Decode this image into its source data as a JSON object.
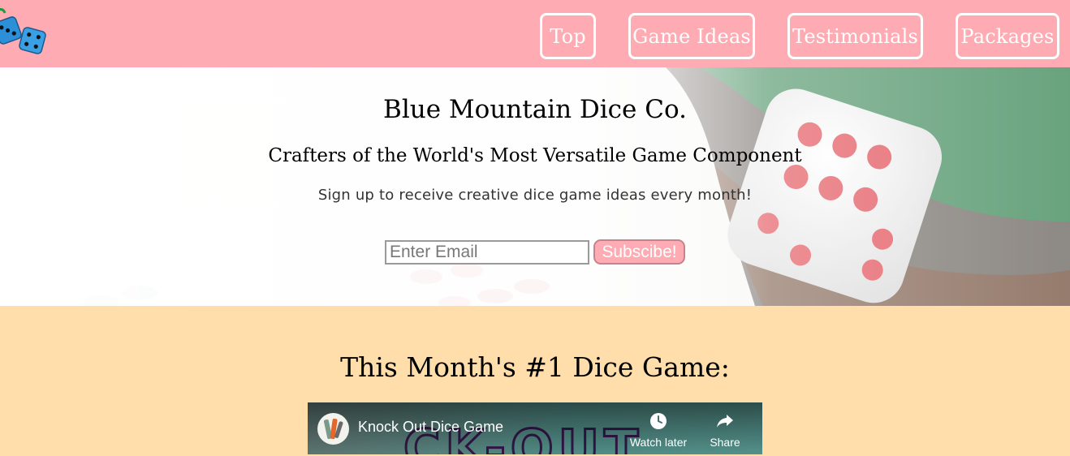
{
  "header": {
    "nav": [
      {
        "label": "Top"
      },
      {
        "label": "Game Ideas"
      },
      {
        "label": "Testimonials"
      },
      {
        "label": "Packages"
      }
    ]
  },
  "hero": {
    "title": "Blue Mountain Dice Co.",
    "subtitle": "Crafters of the World's Most Versatile Game Component",
    "text": "Sign up to receive creative dice game ideas every month!",
    "email_placeholder": "Enter Email",
    "subscribe_label": "Subscibe!"
  },
  "game": {
    "heading": "This Month's #1 Dice Game:",
    "video": {
      "title": "Knock Out Dice Game",
      "watch_later": "Watch later",
      "share": "Share"
    }
  },
  "colors": {
    "header_bg": "#ffabb3",
    "game_section_bg": "#ffdeab"
  },
  "icons": {
    "logo": "dice-logo-icon",
    "watch_later": "clock-icon",
    "share": "share-arrow-icon"
  }
}
